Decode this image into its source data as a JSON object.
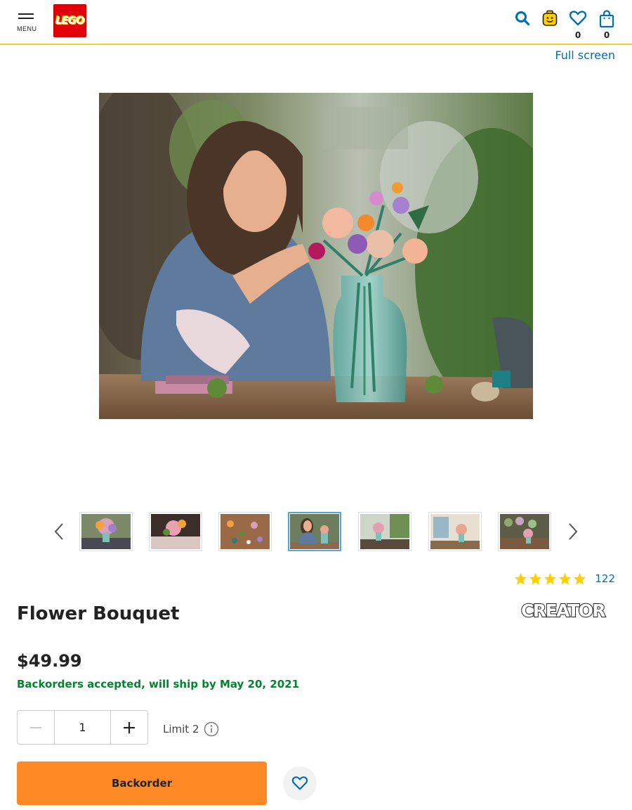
{
  "header": {
    "menu_label": "MENU",
    "logo_text": "LEGO",
    "wishlist_count": "0",
    "bag_count": "0",
    "accent_color": "#f5cd2f",
    "icon_color": "#006db7",
    "logo_color": "#e3000b"
  },
  "gallery": {
    "fullscreen_label": "Full screen",
    "active_thumb_index": 3,
    "thumbs": [
      "bouquet-on-table",
      "bouquet-table-setting",
      "pieces-on-wood",
      "woman-building-bouquet",
      "bouquet-in-window",
      "bouquet-in-room",
      "bouquet-in-market"
    ]
  },
  "rating": {
    "stars": 5,
    "count": "122",
    "star_color": "#ffcf00"
  },
  "product": {
    "title": "Flower Bouquet",
    "brand": "CREATOR",
    "price": "$49.99",
    "availability": "Backorders accepted, will ship by May 20, 2021",
    "availability_color": "#00852b"
  },
  "quantity": {
    "value": "1",
    "limit_label": "Limit 2"
  },
  "actions": {
    "backorder_label": "Backorder",
    "button_color": "#ff8a25"
  }
}
